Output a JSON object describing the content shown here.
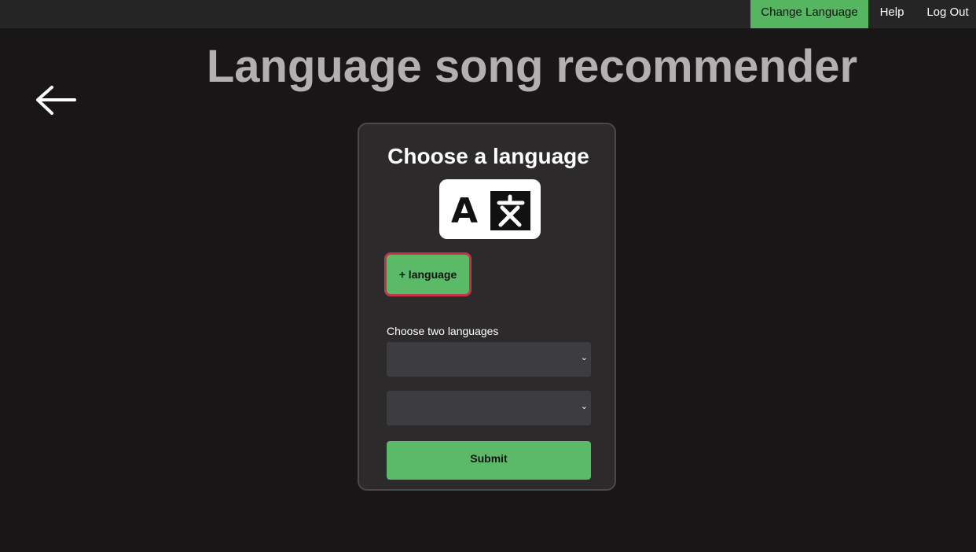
{
  "nav": {
    "change_language": "Change Language",
    "help": "Help",
    "log_out": "Log Out"
  },
  "back": {
    "icon": "arrow-left-icon"
  },
  "title": "Language song recommender",
  "card": {
    "title": "Choose a language",
    "icon": "translate-icon",
    "add_language_label": "+ language",
    "choose_label": "Choose two languages",
    "select_1_value": "",
    "select_2_value": "",
    "chevron": "⌄",
    "submit_label": "Submit"
  },
  "colors": {
    "background": "#181616",
    "navbar": "#252525",
    "accent_green": "#56b561",
    "highlight_red": "#c7334a",
    "title_gray": "#b2b0b0",
    "card": "#2c2a2b"
  }
}
